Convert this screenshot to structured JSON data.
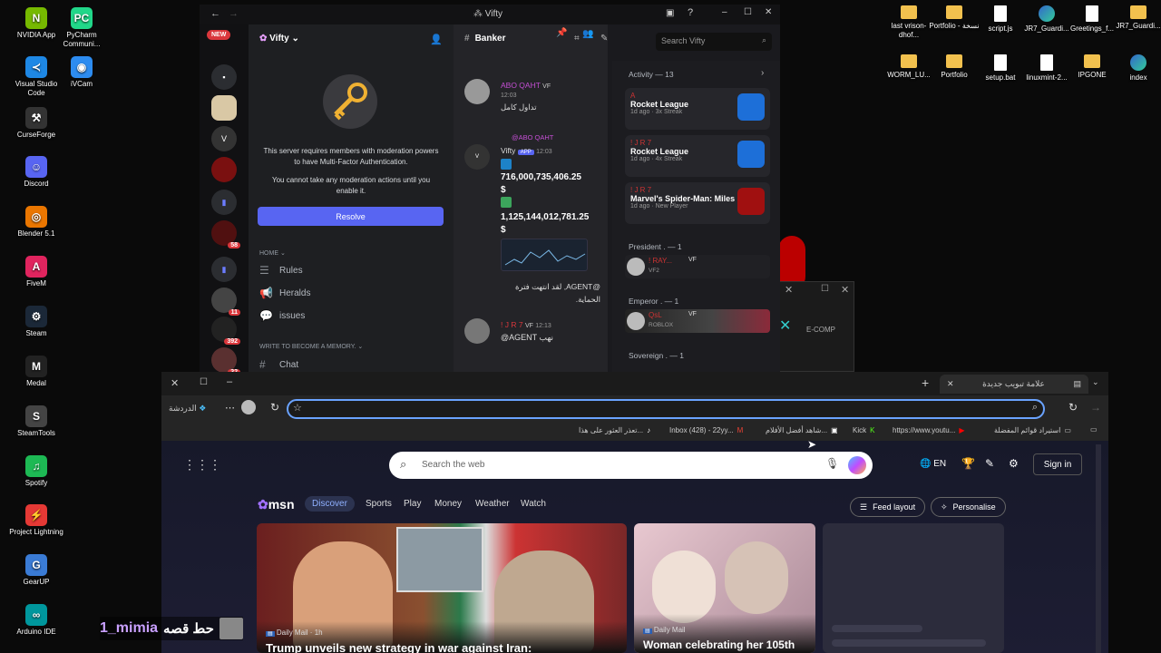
{
  "desktop_left": [
    {
      "label": "NVIDIA App",
      "color": "#76b900",
      "glyph": "N"
    },
    {
      "label": "PyCharm Communi...",
      "color": "#21d789",
      "glyph": "PC"
    },
    {
      "label": "Visual Studio Code",
      "color": "#1e88e5",
      "glyph": "≺"
    },
    {
      "label": "iVCam",
      "color": "#2d8cf0",
      "glyph": "◉"
    },
    {
      "label": "CurseForge",
      "color": "#333",
      "glyph": "⚒"
    },
    {
      "label": "Discord",
      "color": "#5865f2",
      "glyph": "☺"
    },
    {
      "label": "Blender 5.1",
      "color": "#ea7600",
      "glyph": "◎"
    },
    {
      "label": "FiveM",
      "color": "#e0245e",
      "glyph": "A"
    },
    {
      "label": "Steam",
      "color": "#1b2838",
      "glyph": "⚙"
    },
    {
      "label": "Medal",
      "color": "#222",
      "glyph": "M"
    },
    {
      "label": "SteamTools",
      "color": "#444",
      "glyph": "S"
    },
    {
      "label": "Spotify",
      "color": "#1db954",
      "glyph": "♫"
    },
    {
      "label": "Project Lightning",
      "color": "#e53935",
      "glyph": "⚡"
    },
    {
      "label": "GearUP",
      "color": "#3a7bd5",
      "glyph": "G"
    },
    {
      "label": "Arduino IDE",
      "color": "#00979d",
      "glyph": "∞"
    }
  ],
  "desktop_right": [
    {
      "label": "last vrison-dhof...",
      "type": "folder"
    },
    {
      "label": "Portfolio - نسخة",
      "type": "folder"
    },
    {
      "label": "script.js",
      "type": "doc"
    },
    {
      "label": "JR7_Guardi...",
      "type": "edge"
    },
    {
      "label": "Greetings_f...",
      "type": "doc"
    },
    {
      "label": "JR7_Guardi...",
      "type": "folder"
    },
    {
      "label": "WORM_LU...",
      "type": "folder"
    },
    {
      "label": "Portfolio",
      "type": "folder"
    },
    {
      "label": "setup.bat",
      "type": "doc"
    },
    {
      "label": "linuxmint-2...",
      "type": "doc"
    },
    {
      "label": "IPGONE",
      "type": "folder"
    },
    {
      "label": "index",
      "type": "edge"
    }
  ],
  "discord": {
    "window_title": "Vifty",
    "new_badge": "NEW",
    "server_name": "Vifty",
    "guild_badges": [
      "11",
      "392",
      "32",
      "58"
    ],
    "mfa_text_1": "This server requires members with moderation powers to have Multi-Factor Authentication.",
    "mfa_text_2": "You cannot take any moderation actions until you enable it.",
    "resolve_label": "Resolve",
    "home_label": "HOME",
    "channels": [
      {
        "label": "Rules",
        "icon": "rules-icon",
        "glyph": "☰"
      },
      {
        "label": "Heralds",
        "icon": "megaphone-icon",
        "glyph": "📢"
      },
      {
        "label": "issues",
        "icon": "forum-icon",
        "glyph": "💬"
      }
    ],
    "section2": "WRITE TO BECOME A MEMORY.",
    "chat_channel": "Chat",
    "current_channel": "Banker",
    "search_placeholder": "Search Vifty",
    "messages": [
      {
        "author": "ABO QAHT",
        "tag": "VF",
        "time": "12:03",
        "text": "تداول كامل"
      },
      {
        "reply": "@ABO QAHT",
        "author": "Vifty",
        "app": "APP",
        "time": "12:03",
        "line1": "716,000,735,406.25",
        "line2": "$",
        "line3": "1,125,144,012,781.25",
        "line4": "$",
        "after": "@AGENT, لقد انتهت فترة الحماية."
      },
      {
        "author": "! J R 7",
        "tag": "VF",
        "time": "12:13",
        "text": "@AGENT نهب"
      }
    ],
    "activity_header": "Activity — 13",
    "activities": [
      {
        "user": "A",
        "game": "Rocket League",
        "meta": "1d ago · 3x Streak"
      },
      {
        "user": "! J R 7",
        "game": "Rocket League",
        "meta": "1d ago · 4x Streak"
      },
      {
        "user": "! J R 7",
        "game": "Marvel's Spider-Man: Miles ...",
        "meta": "1d ago · New Player"
      }
    ],
    "roles": [
      {
        "name": "President . — 1",
        "member": "! RAY...",
        "tag": "VF",
        "sub": "VF2"
      },
      {
        "name": "Emperor . — 1",
        "member": "QsL",
        "tag": "VF",
        "sub": "ROBLOX"
      },
      {
        "name": "Sovereign . — 1",
        "member": "",
        "tag": "",
        "sub": ""
      }
    ]
  },
  "side_window": {
    "label": "E-COMP"
  },
  "browser": {
    "tab_title": "علامة تبويب جديدة",
    "copilot_label": "الدردشة",
    "address_value": "",
    "favorites": [
      {
        "label": "استيراد قوائم المفضلة",
        "icon": "folder-icon"
      },
      {
        "label": "https://www.youtu...",
        "icon": "youtube-icon"
      },
      {
        "label": "Kick",
        "icon": "kick-icon"
      },
      {
        "label": "شاهد أفضل الأفلام...",
        "icon": "film-icon"
      },
      {
        "label": "Inbox (428) - 22yy...",
        "icon": "gmail-icon"
      },
      {
        "label": "تعذر العثور على هذا...",
        "icon": "tiktok-icon"
      }
    ],
    "search_placeholder": "Search the web",
    "lang": "EN",
    "signin": "Sign in",
    "msn_brand": "msn",
    "nav": [
      "Discover",
      "Sports",
      "Play",
      "Money",
      "Weather",
      "Watch"
    ],
    "feed_layout": "Feed layout",
    "personalise": "Personalise",
    "news": [
      {
        "source": "Daily Mail · 1h",
        "headline": "Trump unveils new strategy in war against Iran:"
      },
      {
        "source": "Daily Mail",
        "headline": "Woman celebrating her 105th"
      }
    ]
  },
  "overlay": {
    "name": "1_mimia",
    "text": "حط قصه"
  }
}
